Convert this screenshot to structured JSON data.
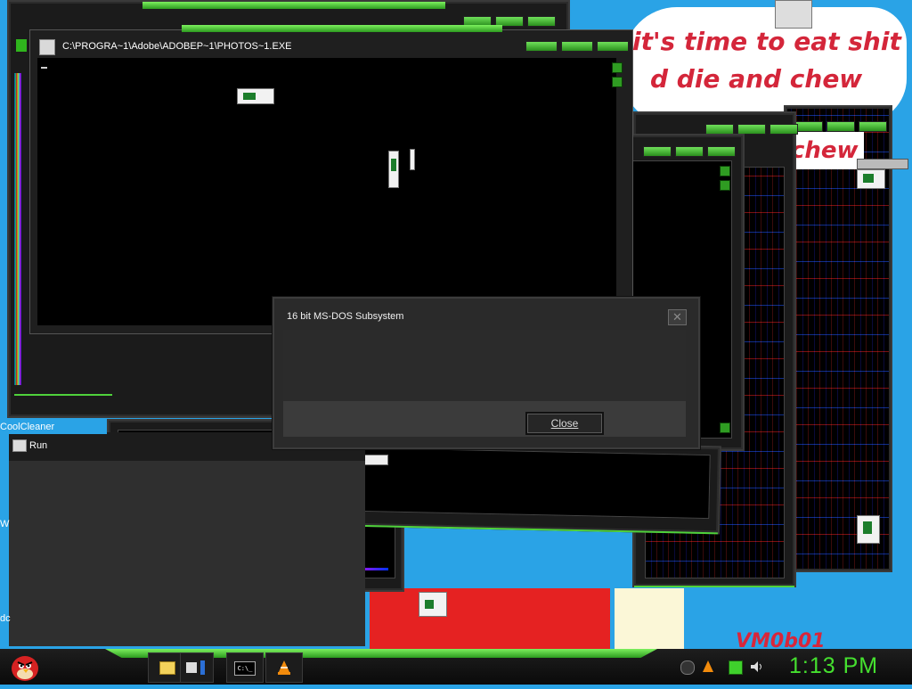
{
  "banner": {
    "line1": "it's time to eat shit",
    "line2": "d die and chew",
    "line3": "chew"
  },
  "console": {
    "title": "C:\\PROGRA~1\\Adobe\\ADOBEP~1\\PHOTOS~1.EXE"
  },
  "dialog": {
    "title": "16 bit MS-DOS Subsystem",
    "close_x": "✕",
    "close_button": "Close"
  },
  "run": {
    "label": "Run",
    "left_fragment_1": "CoolCleaner",
    "left_fragment_2": "W",
    "left_fragment_3": "dc"
  },
  "taskbar": {
    "clock": "1:13 PM",
    "cmd_label": "C:\\_"
  },
  "watermark": "VM0b01",
  "colors": {
    "accent_green": "#4fd23b",
    "desktop_blue": "#2aa3e6",
    "banner_red": "#d4263a",
    "dialog_gray": "#2a2a2a"
  },
  "icons": {
    "start": "angry-bird-icon",
    "folder": "folder-icon",
    "cmd": "command-prompt-icon",
    "vlc": "vlc-cone-icon",
    "volume": "speaker-icon",
    "network": "network-icon"
  }
}
